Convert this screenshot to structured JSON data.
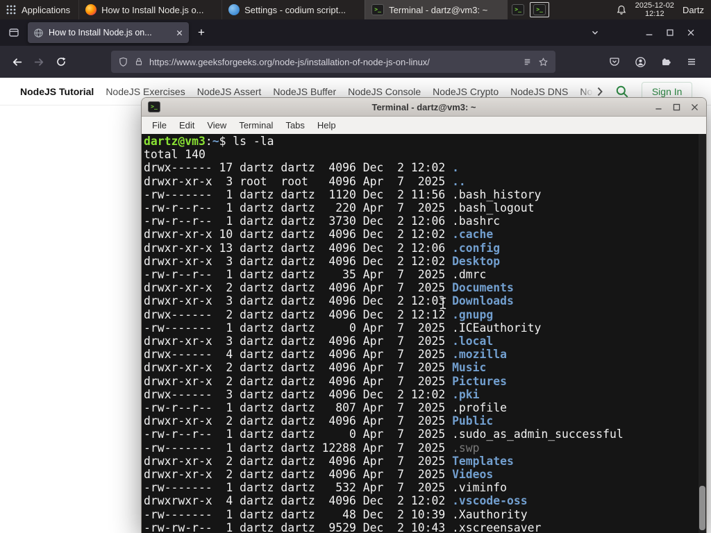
{
  "colors": {
    "panel_bg": "#252222",
    "firefox_chrome_bg": "#1c1b22",
    "firefox_toolbar_bg": "#2b2a33",
    "urlbar_bg": "#42414d",
    "gfg_green": "#2f8d46",
    "terminal_bg": "#151515",
    "terminal_fg": "#f1f1f1",
    "terminal_prompt_green": "#8ae234",
    "terminal_dir_blue": "#729fcf",
    "terminal_dim": "#7a7a7a",
    "terminal_titlebar_bg": "#d3cfcb"
  },
  "panel": {
    "applications_label": "Applications",
    "window_buttons": [
      {
        "label": "How to Install Node.js o...",
        "icon": "firefox-icon"
      },
      {
        "label": "Settings - codium script...",
        "icon": "codium-icon"
      },
      {
        "label": "Terminal - dartz@vm3: ~",
        "icon": "terminal-icon"
      }
    ],
    "tray_icons": [
      "terminal-icon",
      "terminal-indicator-icon"
    ],
    "clock_date": "2025-12-02",
    "clock_time": "12:12",
    "user": "Dartz"
  },
  "browser": {
    "tab": {
      "title": "How to Install Node.js on...",
      "favicon": "globe-icon"
    },
    "new_tab_label": "+",
    "url": "https://www.geeksforgeeks.org/node-js/installation-of-node-js-on-linux/"
  },
  "site_nav": {
    "items": [
      "NodeJS Tutorial",
      "NodeJS Exercises",
      "NodeJS Assert",
      "NodeJS Buffer",
      "NodeJS Console",
      "NodeJS Crypto",
      "NodeJS DNS",
      "Node"
    ],
    "sign_in": "Sign In"
  },
  "terminal": {
    "window_title": "Terminal - dartz@vm3: ~",
    "menu": [
      "File",
      "Edit",
      "View",
      "Terminal",
      "Tabs",
      "Help"
    ],
    "lines": [
      [
        {
          "t": "dartz@vm3",
          "c": "g"
        },
        {
          "t": ":",
          "c": "f"
        },
        {
          "t": "~",
          "c": "b"
        },
        {
          "t": "$ ls -la",
          "c": "f"
        }
      ],
      [
        {
          "t": "total 140",
          "c": "f"
        }
      ],
      [
        {
          "t": "drwx------ 17 dartz dartz  4096 Dec  2 12:02 ",
          "c": "f"
        },
        {
          "t": ".",
          "c": "b"
        }
      ],
      [
        {
          "t": "drwxr-xr-x  3 root  root   4096 Apr  7  2025 ",
          "c": "f"
        },
        {
          "t": "..",
          "c": "b"
        }
      ],
      [
        {
          "t": "-rw-------  1 dartz dartz  1120 Dec  2 11:56 .bash_history",
          "c": "f"
        }
      ],
      [
        {
          "t": "-rw-r--r--  1 dartz dartz   220 Apr  7  2025 .bash_logout",
          "c": "f"
        }
      ],
      [
        {
          "t": "-rw-r--r--  1 dartz dartz  3730 Dec  2 12:06 .bashrc",
          "c": "f"
        }
      ],
      [
        {
          "t": "drwxr-xr-x 10 dartz dartz  4096 Dec  2 12:02 ",
          "c": "f"
        },
        {
          "t": ".cache",
          "c": "b"
        }
      ],
      [
        {
          "t": "drwxr-xr-x 13 dartz dartz  4096 Dec  2 12:06 ",
          "c": "f"
        },
        {
          "t": ".config",
          "c": "b"
        }
      ],
      [
        {
          "t": "drwxr-xr-x  3 dartz dartz  4096 Dec  2 12:02 ",
          "c": "f"
        },
        {
          "t": "Desktop",
          "c": "b"
        }
      ],
      [
        {
          "t": "-rw-r--r--  1 dartz dartz    35 Apr  7  2025 .dmrc",
          "c": "f"
        }
      ],
      [
        {
          "t": "drwxr-xr-x  2 dartz dartz  4096 Apr  7  2025 ",
          "c": "f"
        },
        {
          "t": "Documents",
          "c": "b"
        }
      ],
      [
        {
          "t": "drwxr-xr-x  3 dartz dartz  4096 Dec  2 12:03 ",
          "c": "f"
        },
        {
          "t": "Downloads",
          "c": "b"
        }
      ],
      [
        {
          "t": "drwx------  2 dartz dartz  4096 Dec  2 12:12 ",
          "c": "f"
        },
        {
          "t": ".gnupg",
          "c": "b"
        }
      ],
      [
        {
          "t": "-rw-------  1 dartz dartz     0 Apr  7  2025 .ICEauthority",
          "c": "f"
        }
      ],
      [
        {
          "t": "drwxr-xr-x  3 dartz dartz  4096 Apr  7  2025 ",
          "c": "f"
        },
        {
          "t": ".local",
          "c": "b"
        }
      ],
      [
        {
          "t": "drwx------  4 dartz dartz  4096 Apr  7  2025 ",
          "c": "f"
        },
        {
          "t": ".mozilla",
          "c": "b"
        }
      ],
      [
        {
          "t": "drwxr-xr-x  2 dartz dartz  4096 Apr  7  2025 ",
          "c": "f"
        },
        {
          "t": "Music",
          "c": "b"
        }
      ],
      [
        {
          "t": "drwxr-xr-x  2 dartz dartz  4096 Apr  7  2025 ",
          "c": "f"
        },
        {
          "t": "Pictures",
          "c": "b"
        }
      ],
      [
        {
          "t": "drwx------  3 dartz dartz  4096 Dec  2 12:02 ",
          "c": "f"
        },
        {
          "t": ".pki",
          "c": "b"
        }
      ],
      [
        {
          "t": "-rw-r--r--  1 dartz dartz   807 Apr  7  2025 .profile",
          "c": "f"
        }
      ],
      [
        {
          "t": "drwxr-xr-x  2 dartz dartz  4096 Apr  7  2025 ",
          "c": "f"
        },
        {
          "t": "Public",
          "c": "b"
        }
      ],
      [
        {
          "t": "-rw-r--r--  1 dartz dartz     0 Apr  7  2025 .sudo_as_admin_successful",
          "c": "f"
        }
      ],
      [
        {
          "t": "-rw-------  1 dartz dartz 12288 Apr  7  2025 ",
          "c": "f"
        },
        {
          "t": ".swp",
          "c": "d"
        }
      ],
      [
        {
          "t": "drwxr-xr-x  2 dartz dartz  4096 Apr  7  2025 ",
          "c": "f"
        },
        {
          "t": "Templates",
          "c": "b"
        }
      ],
      [
        {
          "t": "drwxr-xr-x  2 dartz dartz  4096 Apr  7  2025 ",
          "c": "f"
        },
        {
          "t": "Videos",
          "c": "b"
        }
      ],
      [
        {
          "t": "-rw-------  1 dartz dartz   532 Apr  7  2025 .viminfo",
          "c": "f"
        }
      ],
      [
        {
          "t": "drwxrwxr-x  4 dartz dartz  4096 Dec  2 12:02 ",
          "c": "f"
        },
        {
          "t": ".vscode-oss",
          "c": "b"
        }
      ],
      [
        {
          "t": "-rw-------  1 dartz dartz    48 Dec  2 10:39 .Xauthority",
          "c": "f"
        }
      ],
      [
        {
          "t": "-rw-rw-r--  1 dartz dartz  9529 Dec  2 10:43 .xscreensaver",
          "c": "f"
        }
      ]
    ]
  }
}
